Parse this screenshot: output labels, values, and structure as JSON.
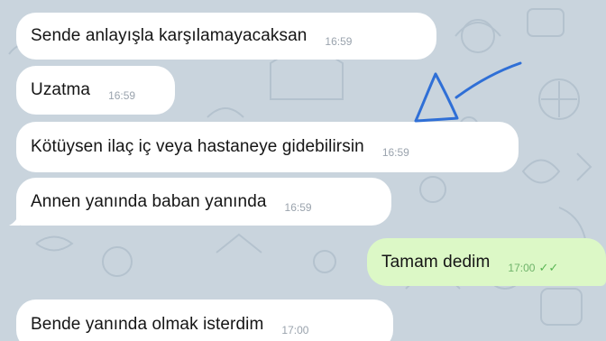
{
  "messages": [
    {
      "text": "Sende anlayışla karşılamayacaksan",
      "time": "16:59"
    },
    {
      "text": "Uzatma",
      "time": "16:59"
    },
    {
      "text": "Kötüysen ilaç iç veya hastaneye gidebilirsin",
      "time": "16:59"
    },
    {
      "text": "Annen yanında baban yanında",
      "time": "16:59"
    },
    {
      "text": "Tamam dedim",
      "time": "17:00",
      "status_icon": "double-check-icon"
    },
    {
      "text": "Bende yanında olmak isterdim",
      "time": "17:00"
    }
  ],
  "colors": {
    "chat_background": "#c9d4dd",
    "incoming_bubble": "#ffffff",
    "outgoing_bubble": "#dcf8c6",
    "annotation_ink": "#2f6fd6"
  },
  "annotation": {
    "icon": "hand-drawn-arrow-icon"
  }
}
